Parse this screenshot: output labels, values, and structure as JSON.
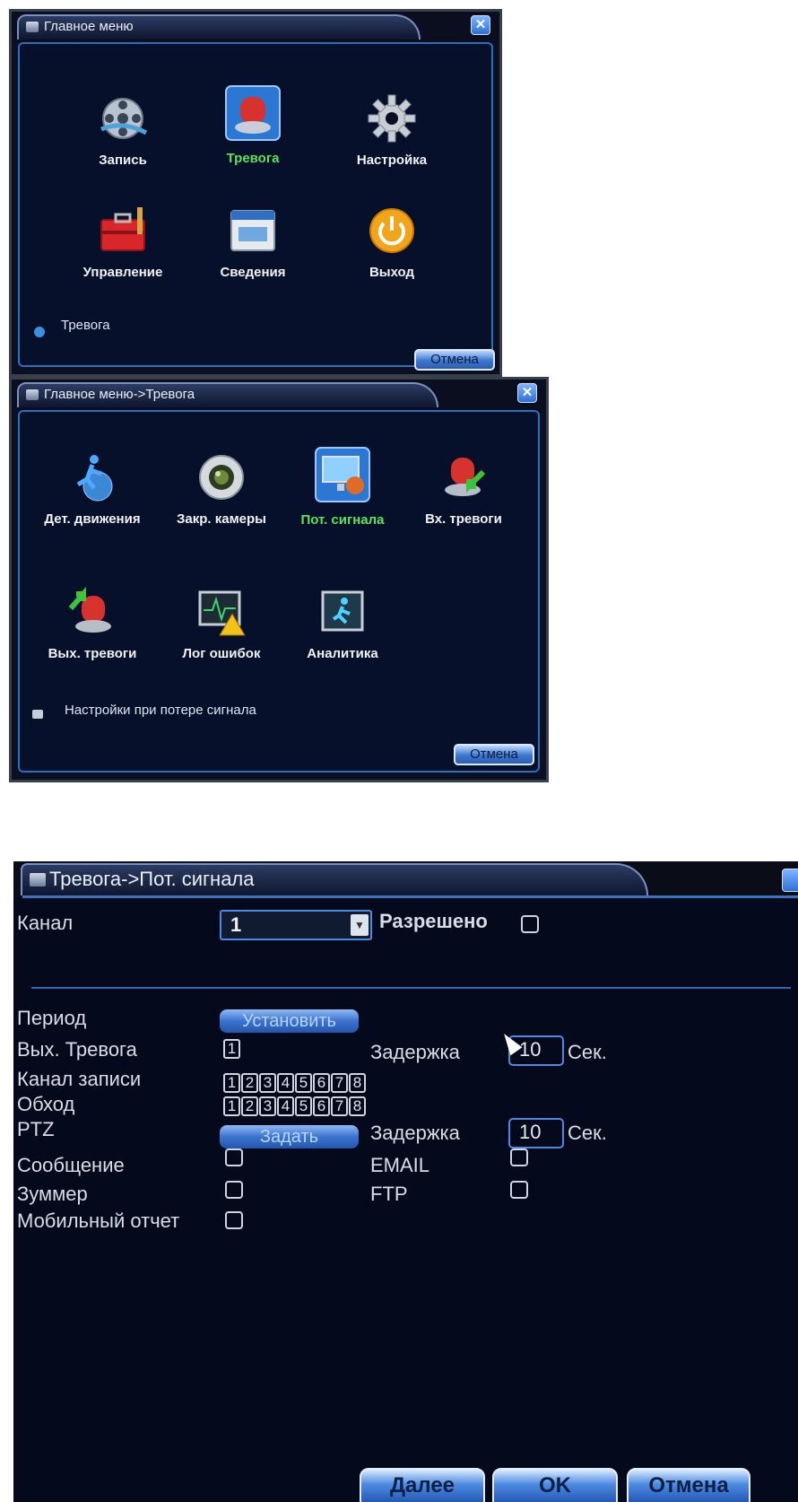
{
  "window1": {
    "title": "Главное меню",
    "items": [
      {
        "label": "Запись",
        "icon": "film-reel-icon"
      },
      {
        "label": "Тревога",
        "icon": "siren-icon"
      },
      {
        "label": "Настройка",
        "icon": "gear-icon"
      },
      {
        "label": "Управление",
        "icon": "toolbox-icon"
      },
      {
        "label": "Сведения",
        "icon": "info-window-icon"
      },
      {
        "label": "Выход",
        "icon": "power-icon"
      }
    ],
    "active_item": "Тревога",
    "status": "Тревога",
    "cancel": "Отмена",
    "close": "✕"
  },
  "window2": {
    "title": "Главное меню->Тревога",
    "items": [
      {
        "label": "Дет. движения",
        "icon": "motion-runner-icon"
      },
      {
        "label": "Закр. камеры",
        "icon": "camera-lens-icon"
      },
      {
        "label": "Пот. сигнала",
        "icon": "monitor-signal-icon"
      },
      {
        "label": "Вх. тревоги",
        "icon": "alarm-in-icon"
      },
      {
        "label": "Вых. тревоги",
        "icon": "alarm-out-icon"
      },
      {
        "label": "Лог ошибок",
        "icon": "error-log-icon"
      },
      {
        "label": "Аналитика",
        "icon": "analytics-icon"
      }
    ],
    "active_item": "Пот. сигнала",
    "status": "Настройки при потере сигнала",
    "cancel": "Отмена",
    "close": "✕"
  },
  "window3": {
    "title": "Тревога->Пот. сигнала",
    "channel_label": "Канал",
    "channel_value": "1",
    "enabled_label": "Разрешено",
    "period_label": "Период",
    "period_button": "Установить",
    "alarm_out_label": "Вых. Тревога",
    "alarm_out_channel": "1",
    "delay_label": "Задержка",
    "delay_value": "10",
    "seconds_label": "Сек.",
    "record_channel_label": "Канал записи",
    "tour_label": "Обход",
    "channels": [
      "1",
      "2",
      "3",
      "4",
      "5",
      "6",
      "7",
      "8"
    ],
    "ptz_label": "PTZ",
    "ptz_button": "Задать",
    "ptz_delay_label": "Задержка",
    "ptz_delay_value": "10",
    "ptz_seconds_label": "Сек.",
    "message_label": "Сообщение",
    "email_label": "EMAIL",
    "buzzer_label": "Зуммер",
    "ftp_label": "FTP",
    "mobile_label": "Мобильный отчет",
    "next_button": "Далее",
    "ok_button": "OK",
    "cancel_button": "Отмена"
  },
  "colors": {
    "panel_bg": "#07102a",
    "border_blue": "#2d6fb9",
    "active_green": "#5de35a",
    "text": "#f2f2f2"
  }
}
